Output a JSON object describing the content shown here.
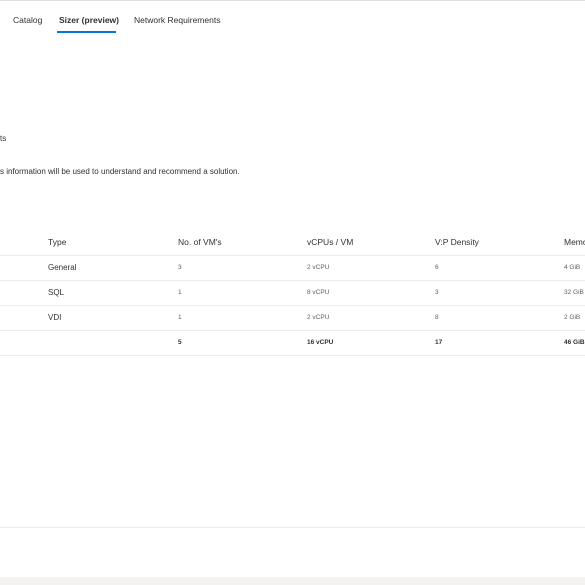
{
  "tabs": [
    {
      "label": "Catalog"
    },
    {
      "label": "Sizer (preview)"
    },
    {
      "label": "Network Requirements"
    }
  ],
  "section_fragment": "ts",
  "description": "s information will be used to understand and recommend a solution.",
  "table": {
    "headers": {
      "type": "Type",
      "vms": "No. of VM's",
      "vcpus": "vCPUs / VM",
      "density": "V:P Density",
      "memory": "Memo"
    },
    "rows": [
      {
        "type": "General",
        "vms": "3",
        "vcpus": "2 vCPU",
        "density": "6",
        "memory": "4 GiB"
      },
      {
        "type": "SQL",
        "vms": "1",
        "vcpus": "8 vCPU",
        "density": "3",
        "memory": "32 GiB"
      },
      {
        "type": "VDI",
        "vms": "1",
        "vcpus": "2 vCPU",
        "density": "8",
        "memory": "2 GiB"
      }
    ],
    "total": {
      "vms": "5",
      "vcpus": "16 vCPU",
      "density": "17",
      "memory": "46 GiB"
    }
  }
}
